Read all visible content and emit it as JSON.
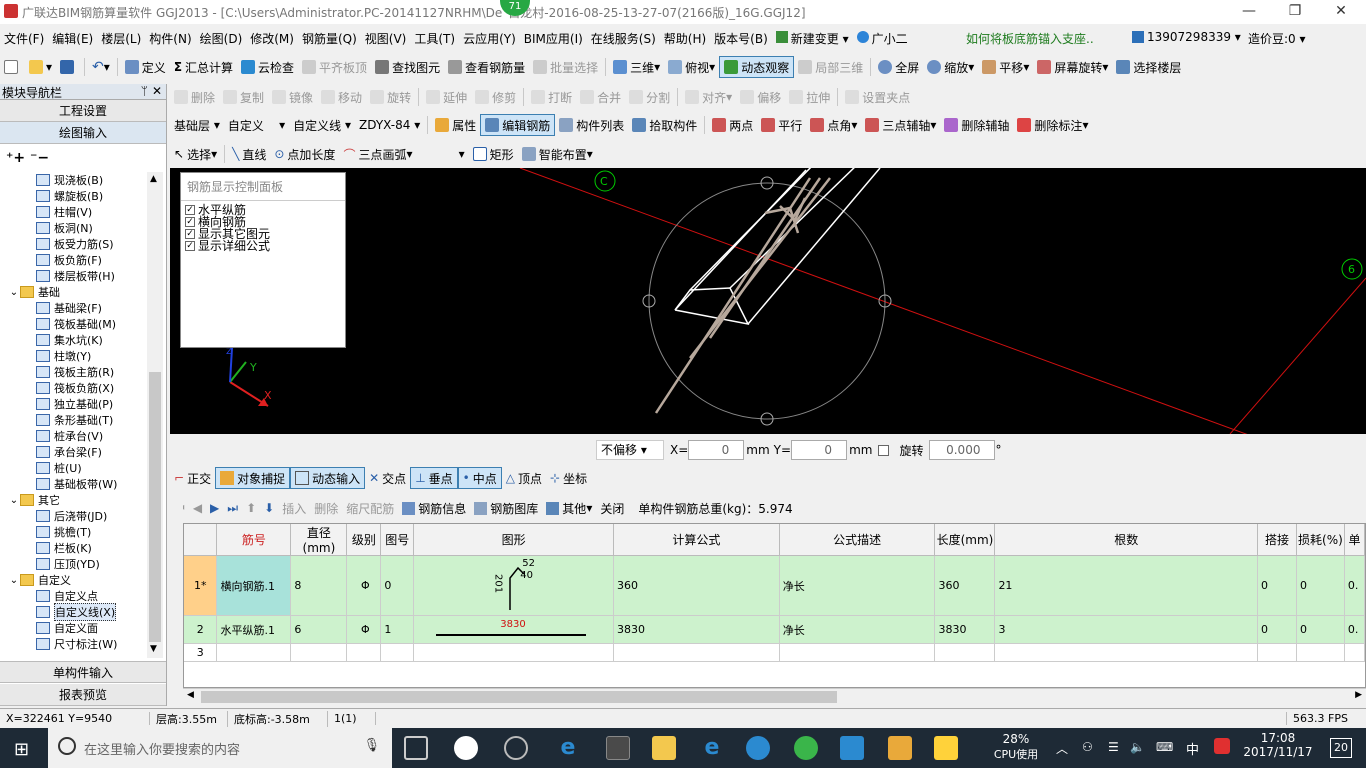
{
  "titlebar": {
    "title": "广联达BIM钢筋算量软件 GGJ2013 - [C:\\Users\\Administrator.PC-20141127NRHM\\De",
    "title_suffix": "白龙村-2016-08-25-13-27-07(2166版)_16G.GGJ12]",
    "badge": "71",
    "minimize": "—",
    "restore": "❐",
    "close": "✕"
  },
  "menubar": {
    "items": [
      "文件(F)",
      "编辑(E)",
      "楼层(L)",
      "构件(N)",
      "绘图(D)",
      "修改(M)",
      "钢筋量(Q)",
      "视图(V)",
      "工具(T)",
      "云应用(Y)",
      "BIM应用(I)",
      "在线服务(S)",
      "帮助(H)",
      "版本号(B)",
      "新建变更",
      "广小二"
    ],
    "tip": "如何将板底筋锚入支座..",
    "phone": "13907298339",
    "price": "造价豆:0"
  },
  "toolbar1": {
    "items": [
      "定义",
      "汇总计算",
      "云检查",
      "平齐板顶",
      "查找图元",
      "查看钢筋量",
      "批量选择",
      "三维",
      "俯视",
      "动态观察",
      "局部三维",
      "全屏",
      "缩放",
      "平移",
      "屏幕旋转",
      "选择楼层"
    ]
  },
  "toolbar2": {
    "items": [
      "删除",
      "复制",
      "镜像",
      "移动",
      "旋转",
      "延伸",
      "修剪",
      "打断",
      "合并",
      "分割",
      "对齐",
      "偏移",
      "拉伸",
      "设置夹点"
    ]
  },
  "toolbar3": {
    "layer": "基础层",
    "type": "自定义",
    "subtype": "自定义线",
    "code": "ZDYX-84",
    "items": [
      "属性",
      "编辑钢筋",
      "构件列表",
      "拾取构件",
      "两点",
      "平行",
      "点角",
      "三点辅轴",
      "删除辅轴",
      "删除标注"
    ]
  },
  "toolbar4": {
    "items": [
      "选择",
      "直线",
      "点加长度",
      "三点画弧",
      "矩形",
      "智能布置"
    ]
  },
  "leftpanel": {
    "title": "模块导航栏",
    "pin": "ᛘ",
    "close": "✕",
    "btn_project": "工程设置",
    "btn_draw": "绘图输入",
    "btn_single": "单构件输入",
    "btn_report": "报表预览",
    "tree": [
      {
        "label": "现浇板(B)",
        "level": 2
      },
      {
        "label": "螺旋板(B)",
        "level": 2
      },
      {
        "label": "柱帽(V)",
        "level": 2
      },
      {
        "label": "板洞(N)",
        "level": 2
      },
      {
        "label": "板受力筋(S)",
        "level": 2
      },
      {
        "label": "板负筋(F)",
        "level": 2
      },
      {
        "label": "楼层板带(H)",
        "level": 2
      },
      {
        "label": "基础",
        "level": 1,
        "folder": true
      },
      {
        "label": "基础梁(F)",
        "level": 2
      },
      {
        "label": "筏板基础(M)",
        "level": 2
      },
      {
        "label": "集水坑(K)",
        "level": 2
      },
      {
        "label": "柱墩(Y)",
        "level": 2
      },
      {
        "label": "筏板主筋(R)",
        "level": 2
      },
      {
        "label": "筏板负筋(X)",
        "level": 2
      },
      {
        "label": "独立基础(P)",
        "level": 2
      },
      {
        "label": "条形基础(T)",
        "level": 2
      },
      {
        "label": "桩承台(V)",
        "level": 2
      },
      {
        "label": "承台梁(F)",
        "level": 2
      },
      {
        "label": "桩(U)",
        "level": 2
      },
      {
        "label": "基础板带(W)",
        "level": 2
      },
      {
        "label": "其它",
        "level": 1,
        "folder": true
      },
      {
        "label": "后浇带(JD)",
        "level": 2
      },
      {
        "label": "挑檐(T)",
        "level": 2
      },
      {
        "label": "栏板(K)",
        "level": 2
      },
      {
        "label": "压顶(YD)",
        "level": 2
      },
      {
        "label": "自定义",
        "level": 1,
        "folder": true
      },
      {
        "label": "自定义点",
        "level": 2
      },
      {
        "label": "自定义线(X)",
        "level": 2,
        "selected": true
      },
      {
        "label": "自定义面",
        "level": 2
      },
      {
        "label": "尺寸标注(W)",
        "level": 2
      }
    ]
  },
  "rebar_panel": {
    "title": "钢筋显示控制面板",
    "options": [
      "水平纵筋",
      "横向钢筋",
      "显示其它图元",
      "显示详细公式"
    ]
  },
  "canvas": {
    "axis_c": "C",
    "axis_6": "6",
    "axis_y": "Y",
    "axis_x": "X",
    "axis_z": "Z"
  },
  "offsetbar": {
    "mode": "不偏移",
    "x_label": "X=",
    "x_value": "0",
    "unit1": "mm",
    "y_label": "Y=",
    "y_value": "0",
    "unit2": "mm",
    "rotate_label": "旋转",
    "rotate_value": "0.000",
    "deg": "°"
  },
  "snapbar": {
    "items": [
      "正交",
      "对象捕捉",
      "动态输入",
      "交点",
      "垂点",
      "中点",
      "顶点",
      "坐标"
    ]
  },
  "gridtoolbar": {
    "items": [
      "插入",
      "删除",
      "缩尺配筋",
      "钢筋信息",
      "钢筋图库",
      "其他",
      "关闭"
    ],
    "total": "单构件钢筋总重(kg)：5.974"
  },
  "grid": {
    "columns": [
      "筋号",
      "直径(mm)",
      "级别",
      "图号",
      "图形",
      "计算公式",
      "公式描述",
      "长度(mm)",
      "根数",
      "搭接",
      "损耗(%)",
      "单"
    ],
    "rows": [
      {
        "rn": "1*",
        "name": "横向钢筋.1",
        "dia": "8",
        "grade": "Φ",
        "fig": "0",
        "shape_a": "52",
        "shape_b": "40",
        "shape_c": "201",
        "formula": "360",
        "desc": "净长",
        "len": "360",
        "count": "21",
        "lap": "0",
        "loss": "0",
        "unit": "0."
      },
      {
        "rn": "2",
        "name": "水平纵筋.1",
        "dia": "6",
        "grade": "Φ",
        "fig": "1",
        "shape_a": "3830",
        "formula": "3830",
        "desc": "净长",
        "len": "3830",
        "count": "3",
        "lap": "0",
        "loss": "0",
        "unit": "0."
      },
      {
        "rn": "3",
        "name": "",
        "dia": "",
        "grade": "",
        "fig": "",
        "formula": "",
        "desc": "",
        "len": "",
        "count": "",
        "lap": "",
        "loss": "",
        "unit": ""
      }
    ]
  },
  "statusbar": {
    "coords": "X=322461 Y=9540",
    "floor_height": "层高:3.55m",
    "bottom_height": "底标高:-3.58m",
    "count": "1(1)",
    "fps": "563.3 FPS"
  },
  "taskbar": {
    "search_placeholder": "在这里输入你要搜索的内容",
    "cpu": "28%",
    "cpu_label": "CPU使用",
    "ime": "中",
    "time": "17:08",
    "date": "2017/11/17",
    "notif": "20"
  }
}
